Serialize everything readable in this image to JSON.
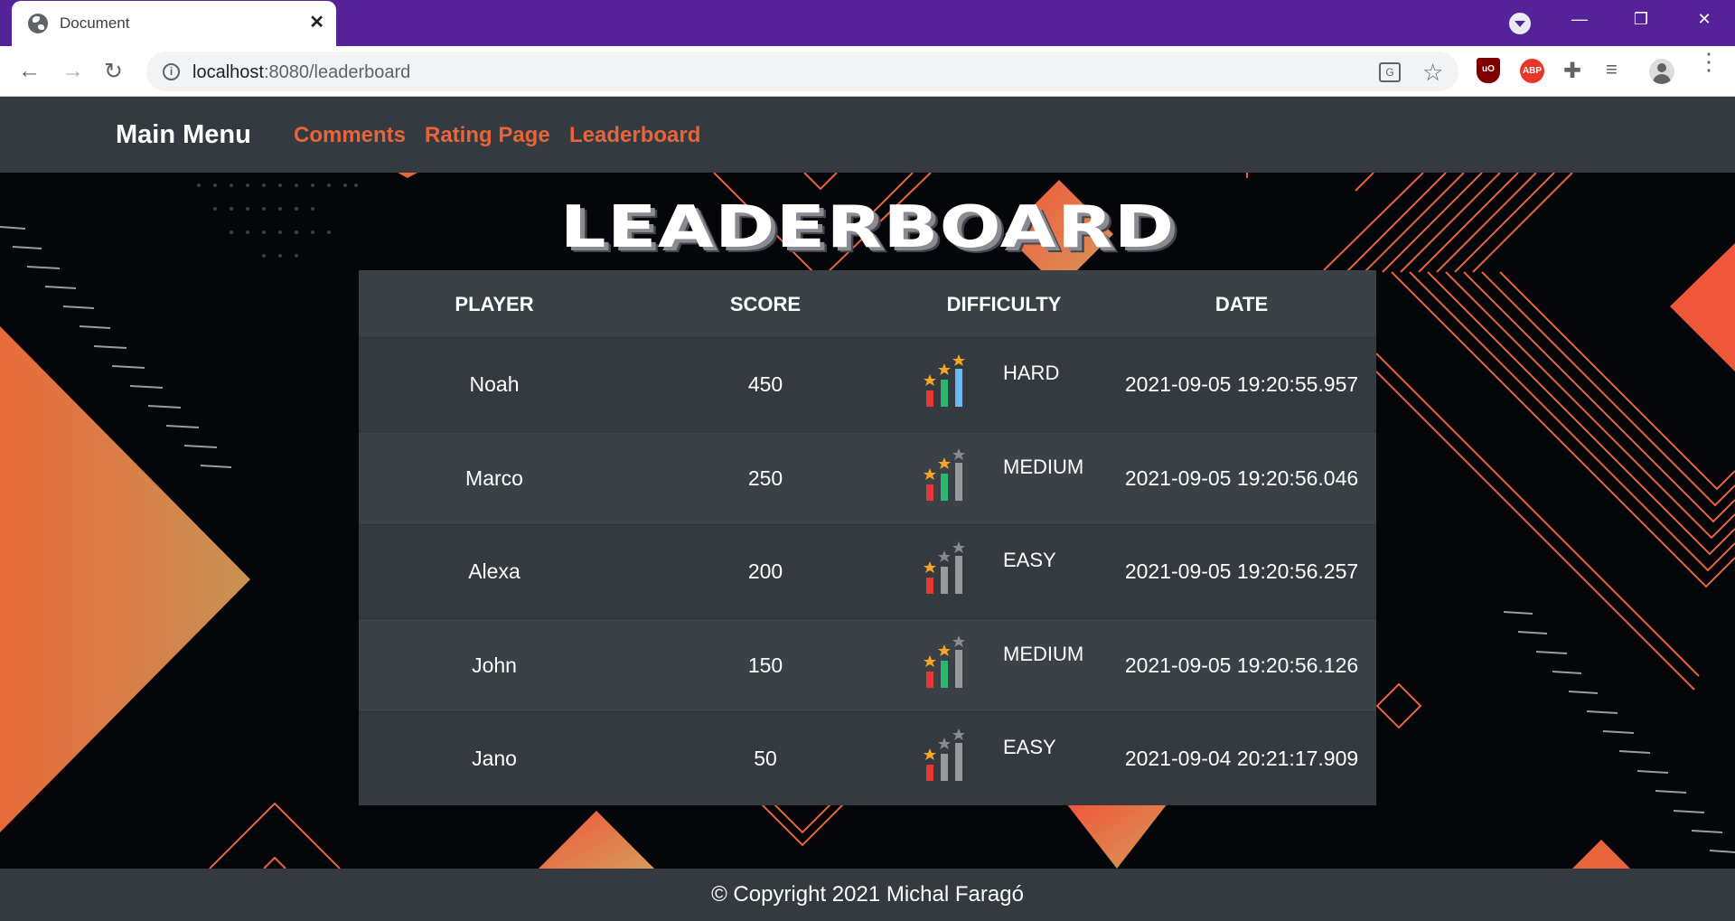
{
  "browser": {
    "tab_title": "Document",
    "tab_close": "✕",
    "url_host": "localhost",
    "url_rest": ":8080/leaderboard",
    "window_minimize": "—",
    "window_restore": "❐",
    "window_close": "✕",
    "extensions": {
      "ublock": "uO",
      "abp": "ABP"
    }
  },
  "navbar": {
    "brand": "Main Menu",
    "links": [
      "Comments",
      "Rating Page",
      "Leaderboard"
    ],
    "link_color": "#e8643a"
  },
  "page": {
    "title": "LEADERBOARD"
  },
  "leaderboard": {
    "headers": [
      "PLAYER",
      "SCORE",
      "DIFFICULTY",
      "DATE"
    ],
    "rows": [
      {
        "player": "Noah",
        "score": "450",
        "difficulty": "HARD",
        "date": "2021-09-05 19:20:55.957",
        "level": 3
      },
      {
        "player": "Marco",
        "score": "250",
        "difficulty": "MEDIUM",
        "date": "2021-09-05 19:20:56.046",
        "level": 2
      },
      {
        "player": "Alexa",
        "score": "200",
        "difficulty": "EASY",
        "date": "2021-09-05 19:20:56.257",
        "level": 1
      },
      {
        "player": "John",
        "score": "150",
        "difficulty": "MEDIUM",
        "date": "2021-09-05 19:20:56.126",
        "level": 2
      },
      {
        "player": "Jano",
        "score": "50",
        "difficulty": "EASY",
        "date": "2021-09-04 20:21:17.909",
        "level": 1
      }
    ]
  },
  "footer": {
    "text": "© Copyright 2021 Michal Faragó"
  },
  "colors": {
    "titlebar": "#55229a",
    "navbar": "#343a40",
    "accent": "#e8643a",
    "star_active": "#f5a623",
    "star_inactive": "#8a8a8a",
    "bar_red": "#e53935",
    "bar_green": "#2bb673",
    "bar_blue": "#6fb8f2",
    "bar_gray": "#9a9a9a"
  }
}
